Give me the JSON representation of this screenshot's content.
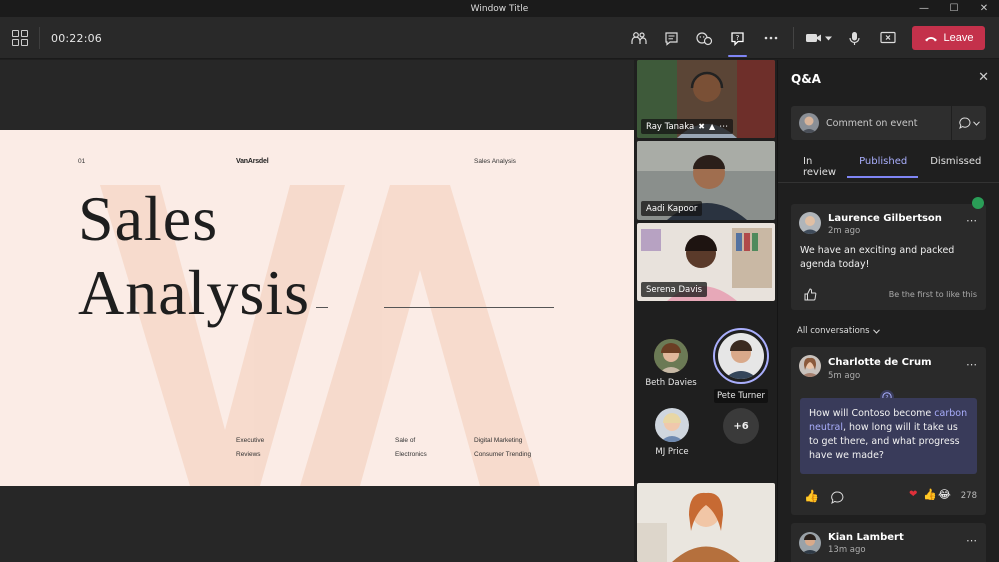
{
  "window": {
    "title": "Window Title"
  },
  "toolbar": {
    "timer": "00:22:06",
    "leave_label": "Leave",
    "accent": "#7f85f5",
    "leave_color": "#c4314b"
  },
  "slide": {
    "top_left": "01",
    "logo": "VanArsdel",
    "top_right": "Sales Analysis",
    "title_line1": "Sales",
    "title_line2": "Analysis",
    "footer_col1_line1": "Executive",
    "footer_col1_line2": "Reviews",
    "footer_col2_line1": "Sale of",
    "footer_col2_line2": "Electronics",
    "footer_col3_line1": "Digital Marketing",
    "footer_col3_line2": "Consumer Trending"
  },
  "gallery": {
    "tiles": [
      {
        "name": "Ray Tanaka"
      },
      {
        "name": "Aadi Kapoor"
      },
      {
        "name": "Serena Davis"
      }
    ],
    "avatars": [
      {
        "name": "Beth Davies"
      },
      {
        "name": "Pete Turner"
      },
      {
        "name": "MJ Price"
      }
    ],
    "overflow_count": "+6"
  },
  "qa": {
    "title": "Q&A",
    "comment_placeholder": "Comment on event",
    "tabs": [
      "In review",
      "Published",
      "Dismissed"
    ],
    "active_tab": "Published",
    "conversations_label": "All conversations",
    "cards": [
      {
        "name": "Laurence Gilbertson",
        "time": "2m ago",
        "body": "We have an exciting and packed agenda today!",
        "like_prompt": "Be the first to like this"
      },
      {
        "name": "Charlotte de Crum",
        "time": "5m ago",
        "question_part1": "How will Contoso become ",
        "question_highlight": "carbon neutral",
        "question_part2": ", how long will it take us to get there, and what progress have we made?",
        "reaction_count": "278"
      },
      {
        "name": "Kian Lambert",
        "time": "13m ago"
      }
    ]
  }
}
